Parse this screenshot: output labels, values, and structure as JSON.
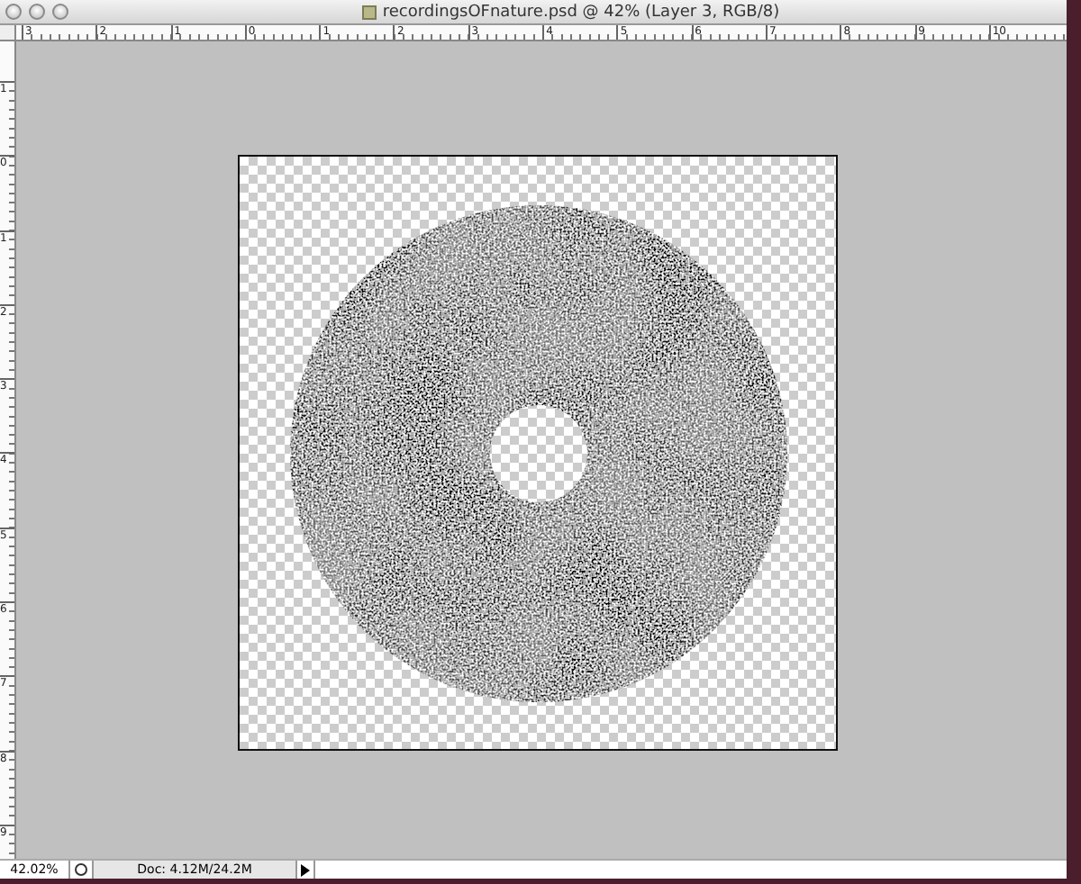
{
  "window": {
    "title": "recordingsOFnature.psd @ 42% (Layer 3, RGB/8)"
  },
  "rulers": {
    "horizontal": [
      "3",
      "2",
      "1",
      "0",
      "1",
      "2",
      "3",
      "4",
      "5",
      "6",
      "7",
      "8",
      "9",
      "10"
    ],
    "vertical": [
      "1",
      "0",
      "1",
      "2",
      "3",
      "4",
      "5",
      "6",
      "7",
      "8",
      "9"
    ]
  },
  "status_bar": {
    "zoom": "42.02%",
    "doc_info": "Doc: 4.12M/24.2M"
  }
}
